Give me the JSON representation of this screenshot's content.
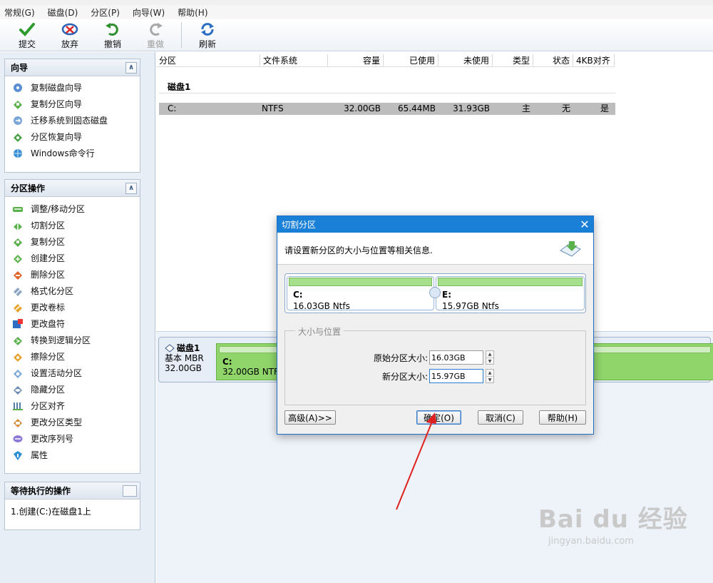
{
  "menu": [
    "常规(G)",
    "磁盘(D)",
    "分区(P)",
    "向导(W)",
    "帮助(H)"
  ],
  "toolbar": {
    "commit": "提交",
    "discard": "放弃",
    "undo": "撤销",
    "redo": "重做",
    "refresh": "刷新"
  },
  "wizard_panel": {
    "title": "向导",
    "items": [
      "复制磁盘向导",
      "复制分区向导",
      "迁移系统到固态磁盘",
      "分区恢复向导",
      "Windows命令行"
    ]
  },
  "ops_panel": {
    "title": "分区操作",
    "items": [
      "调整/移动分区",
      "切割分区",
      "复制分区",
      "创建分区",
      "删除分区",
      "格式化分区",
      "更改卷标",
      "更改盘符",
      "转换到逻辑分区",
      "擦除分区",
      "设置活动分区",
      "隐藏分区",
      "分区对齐",
      "更改分区类型",
      "更改序列号",
      "属性"
    ]
  },
  "pending_panel": {
    "title": "等待执行的操作",
    "items": [
      "1.创建(C:)在磁盘1上"
    ]
  },
  "table": {
    "columns": [
      "分区",
      "文件系统",
      "容量",
      "已使用",
      "未使用",
      "类型",
      "状态",
      "4KB对齐"
    ],
    "disk_label": "磁盘1",
    "rows": [
      {
        "partition": "C:",
        "fs": "NTFS",
        "capacity": "32.00GB",
        "used": "65.44MB",
        "unused": "31.93GB",
        "type": "主",
        "status": "无",
        "aligned": "是"
      }
    ]
  },
  "diskmap": {
    "name": "磁盘1",
    "type": "基本 MBR",
    "size": "32.00GB",
    "part_name": "C:",
    "part_info": "32.00GB NTFS"
  },
  "dialog": {
    "title": "切割分区",
    "description": "请设置新分区的大小与位置等相关信息.",
    "left_part": {
      "name": "C:",
      "size": "16.03GB Ntfs"
    },
    "right_part": {
      "name": "E:",
      "size": "15.97GB Ntfs"
    },
    "group_title": "大小与位置",
    "orig_label": "原始分区大小:",
    "orig_value": "16.03GB",
    "new_label": "新分区大小:",
    "new_value": "15.97GB",
    "advanced": "高级(A)>>",
    "ok": "确定(O)",
    "cancel": "取消(C)",
    "help": "帮助(H)"
  },
  "watermark": {
    "brand": "Bai du 经验",
    "url": "jingyan.baidu.com"
  },
  "colors": {
    "accent": "#1a7fd6",
    "partition_green": "#8fd56a",
    "selected_row": "#bdbdbd",
    "annotation_arrow": "#e02020"
  }
}
